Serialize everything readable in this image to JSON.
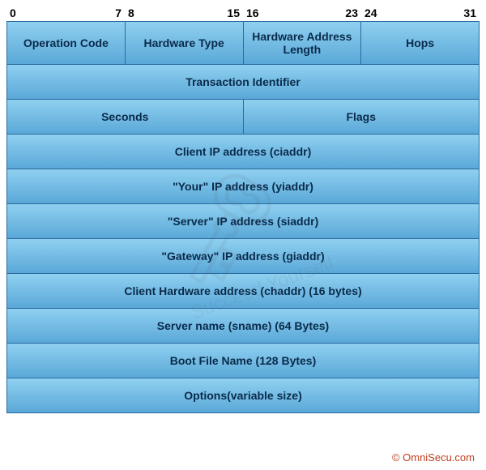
{
  "bit_ruler": {
    "segments": [
      {
        "start": "0",
        "end": "7"
      },
      {
        "start": "8",
        "end": "15"
      },
      {
        "start": "16",
        "end": "23"
      },
      {
        "start": "24",
        "end": "31"
      }
    ]
  },
  "rows": [
    {
      "cells": [
        {
          "label": "Operation Code",
          "width": 8
        },
        {
          "label": "Hardware Type",
          "width": 8
        },
        {
          "label": "Hardware Address Length",
          "width": 8
        },
        {
          "label": "Hops",
          "width": 8
        }
      ]
    },
    {
      "cells": [
        {
          "label": "Transaction Identifier",
          "width": 32
        }
      ]
    },
    {
      "cells": [
        {
          "label": "Seconds",
          "width": 16
        },
        {
          "label": "Flags",
          "width": 16
        }
      ]
    },
    {
      "cells": [
        {
          "label": "Client IP address (ciaddr)",
          "width": 32
        }
      ]
    },
    {
      "cells": [
        {
          "label": "\"Your\" IP address (yiaddr)",
          "width": 32
        }
      ]
    },
    {
      "cells": [
        {
          "label": "\"Server\" IP address (siaddr)",
          "width": 32
        }
      ]
    },
    {
      "cells": [
        {
          "label": "\"Gateway\" IP address (giaddr)",
          "width": 32
        }
      ]
    },
    {
      "cells": [
        {
          "label": "Client Hardware address (chaddr) (16 bytes)",
          "width": 32
        }
      ]
    },
    {
      "cells": [
        {
          "label": "Server name (sname) (64 Bytes)",
          "width": 32
        }
      ]
    },
    {
      "cells": [
        {
          "label": "Boot File Name (128 Bytes)",
          "width": 32
        }
      ]
    },
    {
      "cells": [
        {
          "label": "Options(variable size)",
          "width": 32
        }
      ]
    }
  ],
  "watermark_text": "Succeed Yourself",
  "copyright": "© OmniSecu.com"
}
